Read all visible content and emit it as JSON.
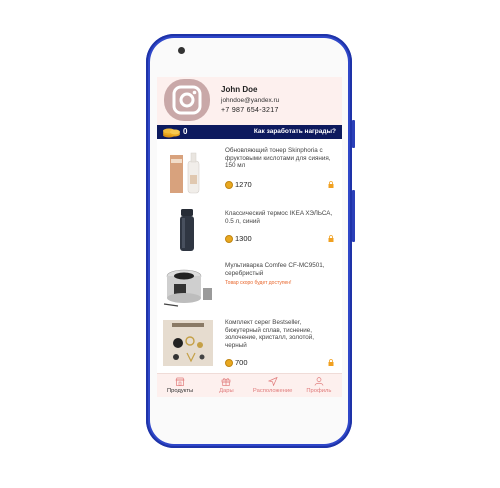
{
  "profile": {
    "name": "John Doe",
    "email": "johndoe@yandex.ru",
    "phone": "+7  987 654-3217"
  },
  "rewards_bar": {
    "count": "0",
    "link": "Как заработать награды?"
  },
  "products": [
    {
      "title": "Обновляющий тонер Skinphoria с фруктовыми кислотами для сияния, 150 мл",
      "price": "1270",
      "locked": true
    },
    {
      "title": "Классический термос IKEA ХЭЛЬСА, 0.5 л, синий",
      "price": "1300",
      "locked": true
    },
    {
      "title": "Мультиварка Comfee CF-MC9501, серебристый",
      "note": "Товар скоро будет доступен!"
    },
    {
      "title": "Комплект серег Bestseller, бижутерный сплав, тиснение, золочение, кристалл, золотой, черный",
      "price": "700",
      "locked": true
    }
  ],
  "tabs": [
    {
      "label": "Продукты",
      "icon": "shop-icon",
      "active": true
    },
    {
      "label": "Дары",
      "icon": "gift-icon"
    },
    {
      "label": "Расположение",
      "icon": "location-arrow-icon"
    },
    {
      "label": "Профиль",
      "icon": "profile-icon"
    }
  ],
  "colors": {
    "phone_frame": "#2f47c9",
    "rewards_bar": "#0d1a5e",
    "profile_bg": "#fdf0ee",
    "accent_coin": "#e9a81f",
    "lock": "#f0a020",
    "tab_inactive": "#e07b7b"
  }
}
